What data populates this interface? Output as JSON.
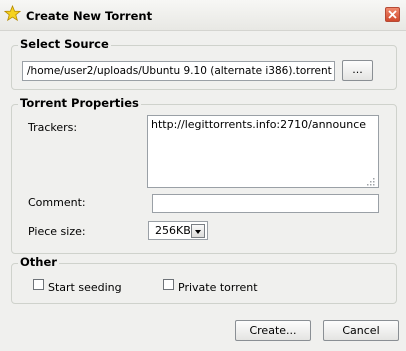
{
  "window": {
    "title": "Create New Torrent"
  },
  "select_source": {
    "legend": "Select Source",
    "path_value": "/home/user2/uploads/Ubuntu 9.10 (alternate i386).torrent",
    "browse_label": "..."
  },
  "torrent_properties": {
    "legend": "Torrent Properties",
    "trackers_label": "Trackers:",
    "trackers_value": "http://legittorrents.info:2710/announce",
    "comment_label": "Comment:",
    "comment_value": "",
    "piece_size_label": "Piece size:",
    "piece_size_value": "256KB"
  },
  "other": {
    "legend": "Other",
    "start_seeding_label": "Start seeding",
    "start_seeding_checked": false,
    "private_torrent_label": "Private torrent",
    "private_torrent_checked": false
  },
  "buttons": {
    "create_label": "Create...",
    "cancel_label": "Cancel"
  },
  "colors": {
    "close_button": "#d0492c",
    "star_icon": "#f5d21e"
  }
}
